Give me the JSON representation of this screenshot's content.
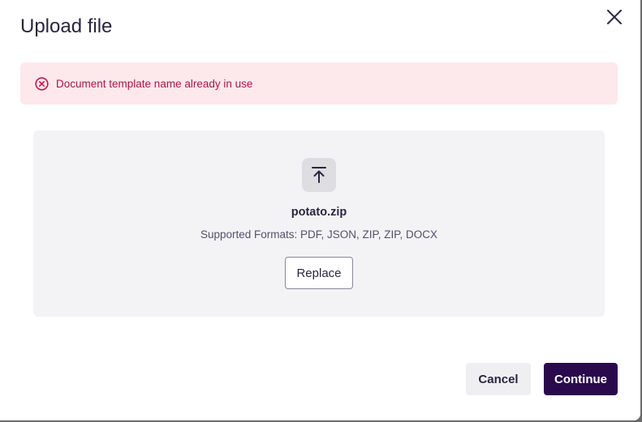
{
  "dialog": {
    "title": "Upload file",
    "close_icon": "close-icon"
  },
  "error": {
    "icon": "error-circle-x-icon",
    "message": "Document template name already in use",
    "color": "#a8174a",
    "background": "#fde8ec"
  },
  "dropzone": {
    "icon": "upload-icon",
    "file_name": "potato.zip",
    "supported_formats": "Supported Formats: PDF, JSON, ZIP, ZIP, DOCX",
    "replace_label": "Replace"
  },
  "footer": {
    "cancel_label": "Cancel",
    "continue_label": "Continue"
  },
  "colors": {
    "primary": "#2a0a4d",
    "text": "#2a2640"
  }
}
